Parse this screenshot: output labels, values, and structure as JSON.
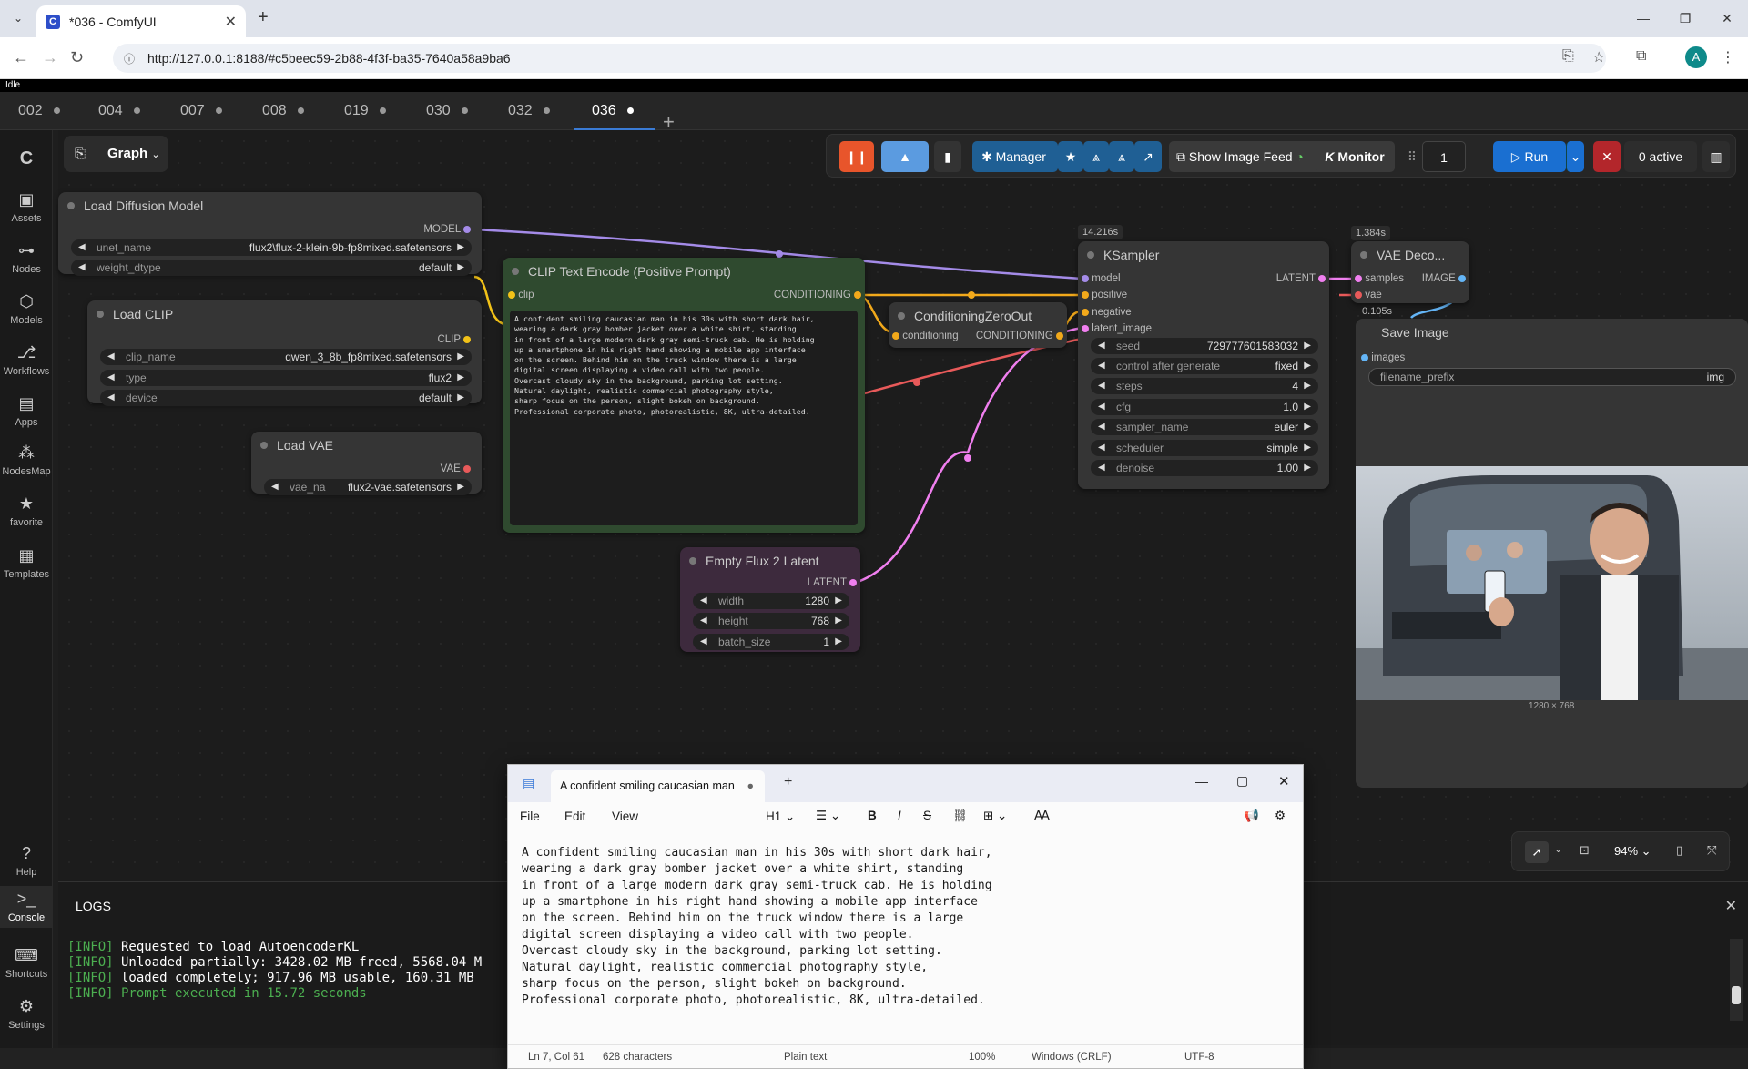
{
  "browser": {
    "tab_title": "*036 - ComfyUI",
    "url": "http://127.0.0.1:8188/#c5beec59-2b88-4f3f-ba35-7640a58a9ba6"
  },
  "status": "Idle",
  "workflow_tabs": [
    {
      "label": "002",
      "active": false
    },
    {
      "label": "004",
      "active": false
    },
    {
      "label": "007",
      "active": false
    },
    {
      "label": "008",
      "active": false
    },
    {
      "label": "019",
      "active": false
    },
    {
      "label": "030",
      "active": false
    },
    {
      "label": "032",
      "active": false
    },
    {
      "label": "036",
      "active": true
    }
  ],
  "sidebar": {
    "items": [
      {
        "label": "Assets",
        "icon": "image-icon"
      },
      {
        "label": "Nodes",
        "icon": "nodes-icon"
      },
      {
        "label": "Models",
        "icon": "models-icon"
      },
      {
        "label": "Workflows",
        "icon": "workflows-icon"
      },
      {
        "label": "Apps",
        "icon": "apps-icon"
      },
      {
        "label": "NodesMap",
        "icon": "nodesmap-icon"
      },
      {
        "label": "favorite",
        "icon": "star-icon"
      },
      {
        "label": "Templates",
        "icon": "templates-icon"
      }
    ],
    "bottom": [
      {
        "label": "Help",
        "icon": "help-icon"
      },
      {
        "label": "Console",
        "icon": "console-icon"
      },
      {
        "label": "Shortcuts",
        "icon": "keyboard-icon"
      },
      {
        "label": "Settings",
        "icon": "gear-icon"
      }
    ]
  },
  "graph_button": "Graph",
  "toolbar": {
    "manager": "Manager",
    "show_image_feed": "Show Image Feed",
    "monitor": "Monitor",
    "queue_count": "1",
    "run": "Run",
    "active": "0 active"
  },
  "nodes": {
    "load_diffusion": {
      "title": "Load Diffusion Model",
      "output": "MODEL",
      "widgets": [
        {
          "label": "unet_name",
          "value": "flux2\\flux-2-klein-9b-fp8mixed.safetensors"
        },
        {
          "label": "weight_dtype",
          "value": "default"
        }
      ]
    },
    "load_clip": {
      "title": "Load CLIP",
      "output": "CLIP",
      "widgets": [
        {
          "label": "clip_name",
          "value": "qwen_3_8b_fp8mixed.safetensors"
        },
        {
          "label": "type",
          "value": "flux2"
        },
        {
          "label": "device",
          "value": "default"
        }
      ]
    },
    "load_vae": {
      "title": "Load VAE",
      "output": "VAE",
      "widgets": [
        {
          "label": "vae_na",
          "value": "flux2-vae.safetensors"
        }
      ]
    },
    "clip_text": {
      "title": "CLIP Text Encode (Positive Prompt)",
      "input": "clip",
      "output": "CONDITIONING",
      "text": "A confident smiling caucasian man in his 30s with short dark hair,\nwearing a dark gray bomber jacket over a white shirt, standing\nin front of a large modern dark gray semi-truck cab. He is holding\nup a smartphone in his right hand showing a mobile app interface\non the screen. Behind him on the truck window there is a large\ndigital screen displaying a video call with two people.\nOvercast cloudy sky in the background, parking lot setting.\nNatural daylight, realistic commercial photography style,\nsharp focus on the person, slight bokeh on background.\nProfessional corporate photo, photorealistic, 8K, ultra-detailed."
    },
    "cond_zero": {
      "title": "ConditioningZeroOut",
      "input": "conditioning",
      "output": "CONDITIONING"
    },
    "empty_latent": {
      "title": "Empty Flux 2 Latent",
      "output": "LATENT",
      "widgets": [
        {
          "label": "width",
          "value": "1280"
        },
        {
          "label": "height",
          "value": "768"
        },
        {
          "label": "batch_size",
          "value": "1"
        }
      ]
    },
    "ksampler": {
      "title": "KSampler",
      "timing": "14.216s",
      "inputs": [
        "model",
        "positive",
        "negative",
        "latent_image"
      ],
      "output": "LATENT",
      "widgets": [
        {
          "label": "seed",
          "value": "729777601583032"
        },
        {
          "label": "control after generate",
          "value": "fixed"
        },
        {
          "label": "steps",
          "value": "4"
        },
        {
          "label": "cfg",
          "value": "1.0"
        },
        {
          "label": "sampler_name",
          "value": "euler"
        },
        {
          "label": "scheduler",
          "value": "simple"
        },
        {
          "label": "denoise",
          "value": "1.00"
        }
      ]
    },
    "vae_decode": {
      "title": "VAE Deco...",
      "timing": "1.384s",
      "timing2": "0.105s",
      "inputs": [
        "samples",
        "vae"
      ],
      "output": "IMAGE"
    },
    "save_image": {
      "title": "Save Image",
      "input": "images",
      "widget_label": "filename_prefix",
      "widget_value": "img",
      "image_size": "1280 × 768"
    }
  },
  "notepad": {
    "tab_title": "A confident smiling caucasian man",
    "menu": [
      "File",
      "Edit",
      "View"
    ],
    "heading": "H1",
    "text": "A confident smiling caucasian man in his 30s with short dark hair,\nwearing a dark gray bomber jacket over a white shirt, standing\nin front of a large modern dark gray semi-truck cab. He is holding\nup a smartphone in his right hand showing a mobile app interface\non the screen. Behind him on the truck window there is a large\ndigital screen displaying a video call with two people.\nOvercast cloudy sky in the background, parking lot setting.\nNatural daylight, realistic commercial photography style,\nsharp focus on the person, slight bokeh on background.\nProfessional corporate photo, photorealistic, 8K, ultra-detailed.",
    "status": {
      "position": "Ln 7, Col 61",
      "chars": "628 characters",
      "format": "Plain text",
      "zoom": "100%",
      "eol": "Windows (CRLF)",
      "encoding": "UTF-8"
    }
  },
  "logs": {
    "title": "LOGS",
    "lines": [
      {
        "tag": "[INFO]",
        "text": " Requested to load AutoencoderKL",
        "ok": false
      },
      {
        "tag": "[INFO]",
        "text": " Unloaded partially: 3428.02 MB freed, 5568.04 M",
        "ok": false
      },
      {
        "tag": "[INFO]",
        "text": " loaded completely; 917.96 MB usable, 160.31 MB",
        "ok": false
      },
      {
        "tag": "[INFO]",
        "text": " Prompt executed in 15.72 seconds",
        "ok": true
      }
    ]
  },
  "canvas_controls": {
    "zoom": "94%"
  },
  "colors": {
    "accent": "#1a6fd1",
    "run": "#1a6fd1",
    "clip_node": "#2f4a2f",
    "latent_node": "#3d2a3d"
  }
}
